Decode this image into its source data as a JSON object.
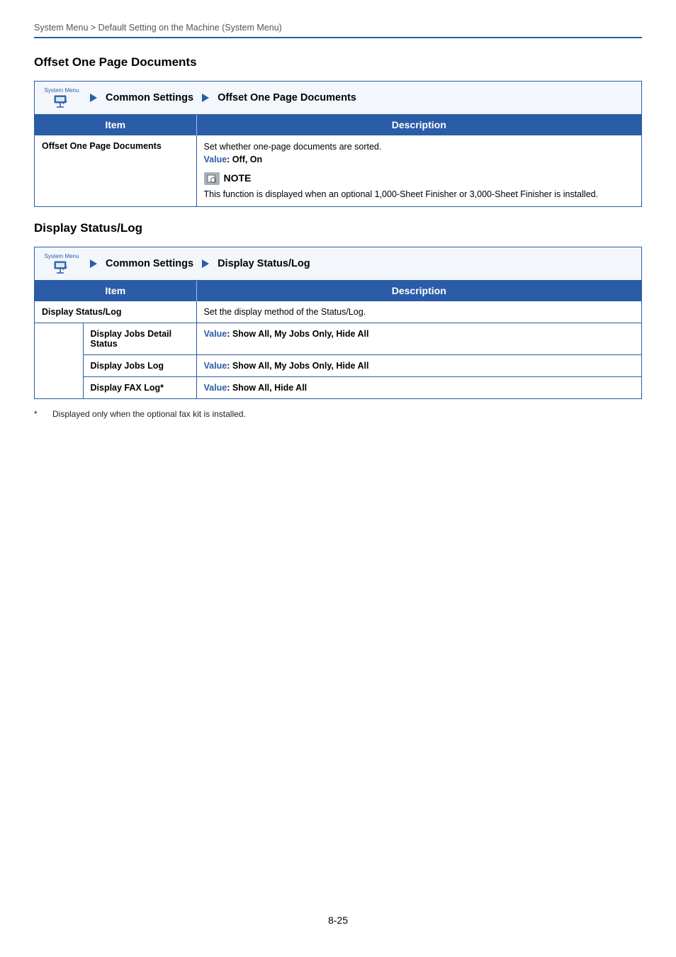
{
  "header": "System Menu > Default Setting on the Machine (System Menu)",
  "section1": {
    "title": "Offset One Page Documents",
    "breadcrumb": {
      "sm": "System Menu",
      "l1": "Common Settings",
      "l2": "Offset One Page Documents"
    },
    "th_item": "Item",
    "th_desc": "Description",
    "row_item": "Offset One Page Documents",
    "row_desc": "Set whether one-page documents are sorted.",
    "value_label": "Value",
    "value_text": ": Off, On",
    "note_label": "NOTE",
    "note_body": "This function is displayed when an optional 1,000-Sheet Finisher or 3,000-Sheet Finisher is installed."
  },
  "section2": {
    "title": "Display Status/Log",
    "breadcrumb": {
      "sm": "System Menu",
      "l1": "Common Settings",
      "l2": "Display Status/Log"
    },
    "th_item": "Item",
    "th_desc": "Description",
    "row1_item": "Display Status/Log",
    "row1_desc": "Set the display method of the Status/Log.",
    "row2_item": "Display Jobs Detail Status",
    "row2_val": ": Show All, My Jobs Only, Hide All",
    "row3_item": "Display Jobs Log",
    "row3_val": ": Show All, My Jobs Only, Hide All",
    "row4_item": "Display FAX Log*",
    "row4_val": ": Show All, Hide All",
    "value_label": "Value"
  },
  "footnote_ast": "*",
  "footnote": "Displayed only when the optional fax kit is installed.",
  "page_number": "8-25"
}
